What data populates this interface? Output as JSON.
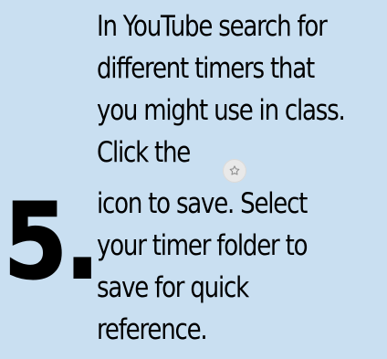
{
  "slide": {
    "step_number": "5.",
    "instruction_lines": [
      "In YouTube search for",
      "different timers that",
      "you might use in class.",
      "Click the",
      "icon to save. Select",
      "your timer folder to",
      "save for quick",
      "reference."
    ],
    "icon": {
      "name": "star-icon",
      "background": "#e9e9e9",
      "color": "#8f8f8f"
    },
    "colors": {
      "background": "#c9dff1",
      "text": "#000000"
    }
  }
}
